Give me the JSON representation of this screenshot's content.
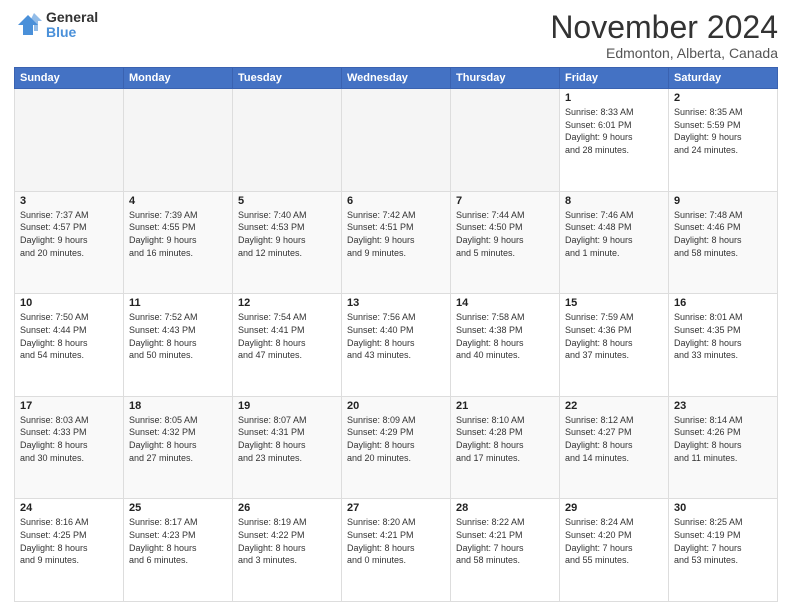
{
  "logo": {
    "line1": "General",
    "line2": "Blue"
  },
  "header": {
    "month": "November 2024",
    "location": "Edmonton, Alberta, Canada"
  },
  "weekdays": [
    "Sunday",
    "Monday",
    "Tuesday",
    "Wednesday",
    "Thursday",
    "Friday",
    "Saturday"
  ],
  "weeks": [
    [
      {
        "day": "",
        "info": ""
      },
      {
        "day": "",
        "info": ""
      },
      {
        "day": "",
        "info": ""
      },
      {
        "day": "",
        "info": ""
      },
      {
        "day": "",
        "info": ""
      },
      {
        "day": "1",
        "info": "Sunrise: 8:33 AM\nSunset: 6:01 PM\nDaylight: 9 hours\nand 28 minutes."
      },
      {
        "day": "2",
        "info": "Sunrise: 8:35 AM\nSunset: 5:59 PM\nDaylight: 9 hours\nand 24 minutes."
      }
    ],
    [
      {
        "day": "3",
        "info": "Sunrise: 7:37 AM\nSunset: 4:57 PM\nDaylight: 9 hours\nand 20 minutes."
      },
      {
        "day": "4",
        "info": "Sunrise: 7:39 AM\nSunset: 4:55 PM\nDaylight: 9 hours\nand 16 minutes."
      },
      {
        "day": "5",
        "info": "Sunrise: 7:40 AM\nSunset: 4:53 PM\nDaylight: 9 hours\nand 12 minutes."
      },
      {
        "day": "6",
        "info": "Sunrise: 7:42 AM\nSunset: 4:51 PM\nDaylight: 9 hours\nand 9 minutes."
      },
      {
        "day": "7",
        "info": "Sunrise: 7:44 AM\nSunset: 4:50 PM\nDaylight: 9 hours\nand 5 minutes."
      },
      {
        "day": "8",
        "info": "Sunrise: 7:46 AM\nSunset: 4:48 PM\nDaylight: 9 hours\nand 1 minute."
      },
      {
        "day": "9",
        "info": "Sunrise: 7:48 AM\nSunset: 4:46 PM\nDaylight: 8 hours\nand 58 minutes."
      }
    ],
    [
      {
        "day": "10",
        "info": "Sunrise: 7:50 AM\nSunset: 4:44 PM\nDaylight: 8 hours\nand 54 minutes."
      },
      {
        "day": "11",
        "info": "Sunrise: 7:52 AM\nSunset: 4:43 PM\nDaylight: 8 hours\nand 50 minutes."
      },
      {
        "day": "12",
        "info": "Sunrise: 7:54 AM\nSunset: 4:41 PM\nDaylight: 8 hours\nand 47 minutes."
      },
      {
        "day": "13",
        "info": "Sunrise: 7:56 AM\nSunset: 4:40 PM\nDaylight: 8 hours\nand 43 minutes."
      },
      {
        "day": "14",
        "info": "Sunrise: 7:58 AM\nSunset: 4:38 PM\nDaylight: 8 hours\nand 40 minutes."
      },
      {
        "day": "15",
        "info": "Sunrise: 7:59 AM\nSunset: 4:36 PM\nDaylight: 8 hours\nand 37 minutes."
      },
      {
        "day": "16",
        "info": "Sunrise: 8:01 AM\nSunset: 4:35 PM\nDaylight: 8 hours\nand 33 minutes."
      }
    ],
    [
      {
        "day": "17",
        "info": "Sunrise: 8:03 AM\nSunset: 4:33 PM\nDaylight: 8 hours\nand 30 minutes."
      },
      {
        "day": "18",
        "info": "Sunrise: 8:05 AM\nSunset: 4:32 PM\nDaylight: 8 hours\nand 27 minutes."
      },
      {
        "day": "19",
        "info": "Sunrise: 8:07 AM\nSunset: 4:31 PM\nDaylight: 8 hours\nand 23 minutes."
      },
      {
        "day": "20",
        "info": "Sunrise: 8:09 AM\nSunset: 4:29 PM\nDaylight: 8 hours\nand 20 minutes."
      },
      {
        "day": "21",
        "info": "Sunrise: 8:10 AM\nSunset: 4:28 PM\nDaylight: 8 hours\nand 17 minutes."
      },
      {
        "day": "22",
        "info": "Sunrise: 8:12 AM\nSunset: 4:27 PM\nDaylight: 8 hours\nand 14 minutes."
      },
      {
        "day": "23",
        "info": "Sunrise: 8:14 AM\nSunset: 4:26 PM\nDaylight: 8 hours\nand 11 minutes."
      }
    ],
    [
      {
        "day": "24",
        "info": "Sunrise: 8:16 AM\nSunset: 4:25 PM\nDaylight: 8 hours\nand 9 minutes."
      },
      {
        "day": "25",
        "info": "Sunrise: 8:17 AM\nSunset: 4:23 PM\nDaylight: 8 hours\nand 6 minutes."
      },
      {
        "day": "26",
        "info": "Sunrise: 8:19 AM\nSunset: 4:22 PM\nDaylight: 8 hours\nand 3 minutes."
      },
      {
        "day": "27",
        "info": "Sunrise: 8:20 AM\nSunset: 4:21 PM\nDaylight: 8 hours\nand 0 minutes."
      },
      {
        "day": "28",
        "info": "Sunrise: 8:22 AM\nSunset: 4:21 PM\nDaylight: 7 hours\nand 58 minutes."
      },
      {
        "day": "29",
        "info": "Sunrise: 8:24 AM\nSunset: 4:20 PM\nDaylight: 7 hours\nand 55 minutes."
      },
      {
        "day": "30",
        "info": "Sunrise: 8:25 AM\nSunset: 4:19 PM\nDaylight: 7 hours\nand 53 minutes."
      }
    ]
  ]
}
